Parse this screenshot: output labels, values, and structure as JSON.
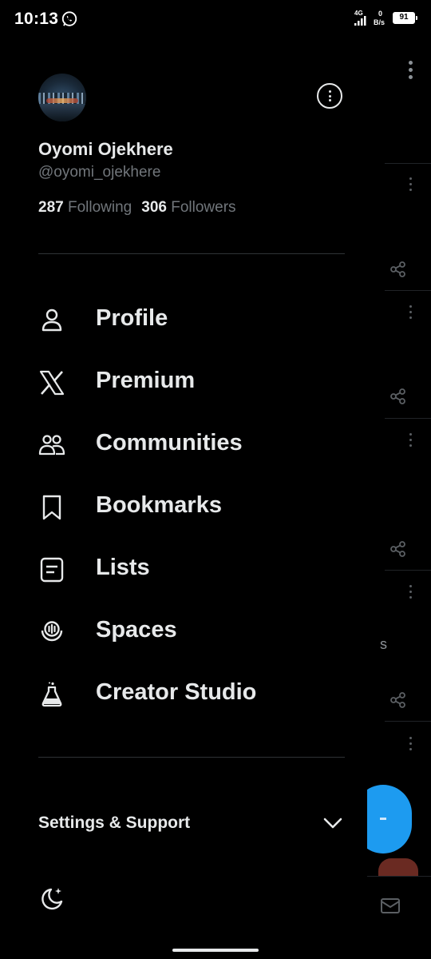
{
  "status_bar": {
    "time": "10:13",
    "network_type": "4G",
    "data_speed_value": "0",
    "data_speed_unit": "B/s",
    "battery_level": "91"
  },
  "profile": {
    "display_name": "Oyomi Ojekhere",
    "handle": "@oyomi_ojekhere",
    "following_count": "287",
    "following_label": "Following",
    "followers_count": "306",
    "followers_label": "Followers"
  },
  "nav": {
    "items": [
      {
        "label": "Profile",
        "icon": "person-icon"
      },
      {
        "label": "Premium",
        "icon": "x-logo-icon"
      },
      {
        "label": "Communities",
        "icon": "communities-icon"
      },
      {
        "label": "Bookmarks",
        "icon": "bookmark-icon"
      },
      {
        "label": "Lists",
        "icon": "list-icon"
      },
      {
        "label": "Spaces",
        "icon": "spaces-icon"
      },
      {
        "label": "Creator Studio",
        "icon": "flask-icon"
      }
    ]
  },
  "settings": {
    "label": "Settings & Support"
  },
  "background_timeline": {
    "partial_text": "s"
  },
  "colors": {
    "background": "#000000",
    "primary_text": "#e7e9ea",
    "secondary_text": "#71767b",
    "divider": "#2f3336",
    "accent": "#1d9bf0"
  }
}
